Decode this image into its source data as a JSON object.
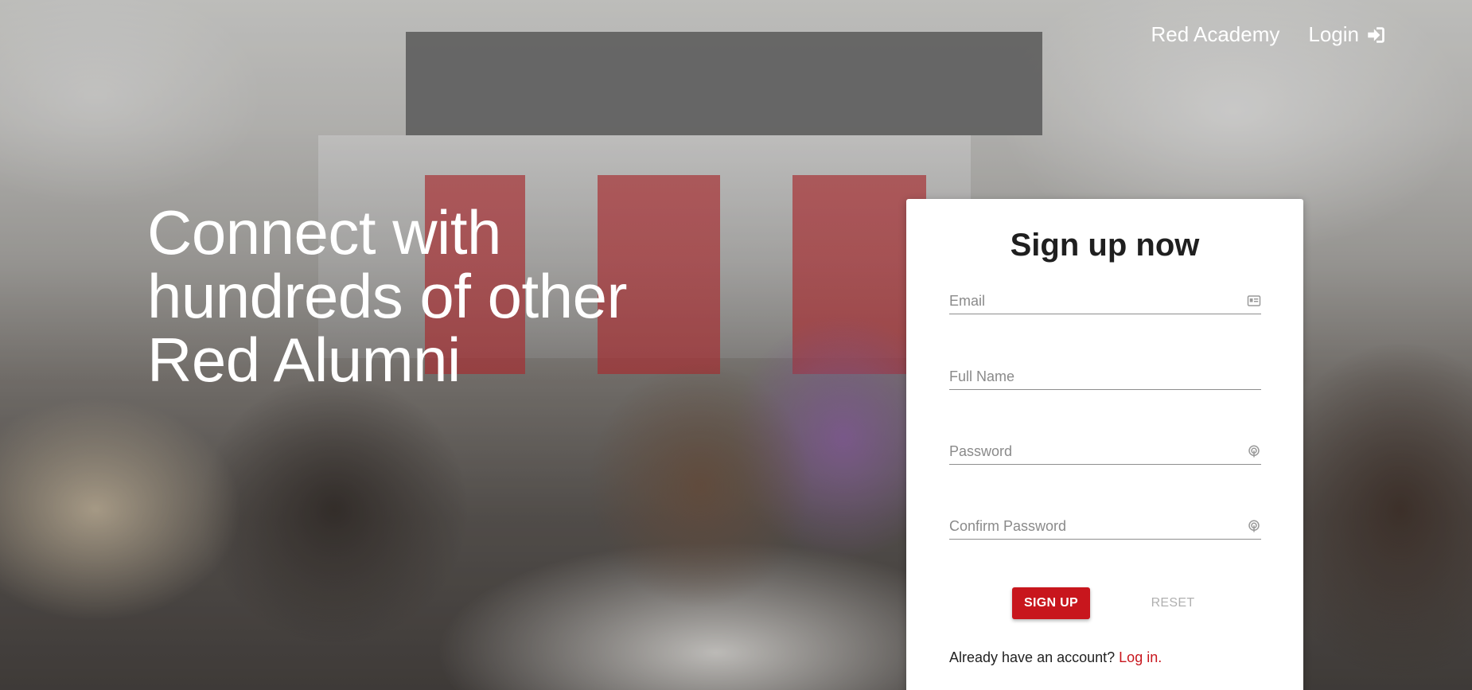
{
  "nav": {
    "brand": "Red Academy",
    "login_label": "Login",
    "login_icon": "sign-in-icon"
  },
  "hero": {
    "line1": "Connect with",
    "line2": "hundreds of other",
    "line3": "Red Alumni"
  },
  "form": {
    "title": "Sign up now",
    "email_placeholder": "Email",
    "email_icon": "id-card-icon",
    "fullname_placeholder": "Full Name",
    "password_placeholder": "Password",
    "password_icon": "fingerprint-icon",
    "confirm_placeholder": "Confirm Password",
    "confirm_icon": "fingerprint-icon",
    "signup_label": "SIGN UP",
    "reset_label": "RESET",
    "already_text": "Already have an account?",
    "login_link": "Log in."
  },
  "colors": {
    "accent": "#c8161d",
    "card_bg": "#ffffff",
    "hero_text": "#ffffff"
  }
}
